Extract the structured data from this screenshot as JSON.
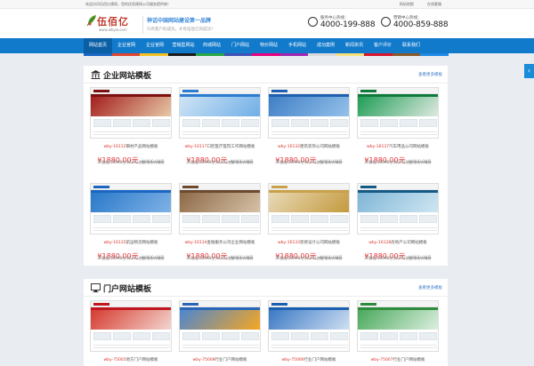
{
  "topbar": {
    "welcome": "欢迎访问伍佰亿建网，您的优质建网公司服务提供商！",
    "links": [
      "网站地图",
      "在线客服"
    ]
  },
  "brand": {
    "logo_text": "伍佰亿",
    "domain": "www.wbyw.com",
    "slogan": "神话中国网站建设第一品牌",
    "subslogan": "只有客户的成功，才有伍佰亿的成功！"
  },
  "hotlines": [
    {
      "label": "服务中心热线：",
      "number": "4000-199-888"
    },
    {
      "label": "营销中心热线：",
      "number": "4000-859-888"
    }
  ],
  "nav": [
    "网站首页",
    "企业官网",
    "企业官网",
    "营销型网站",
    "商城网站",
    "门户网站",
    "特价网站",
    "手机网站",
    "成功案例",
    "新闻资讯",
    "客户评价",
    "联系我们"
  ],
  "colorstrip": [
    "#1a66c4",
    "#e0452e",
    "#f5c022",
    "#1b1b1b",
    "#28a745",
    "#3f51b5",
    "#e6007e",
    "#9c27b0",
    "#d9d9d9",
    "#f5e07a",
    "#d7152d",
    "#8b5a2b",
    "#1e88e5"
  ],
  "side_tab": "‹",
  "section1": {
    "title": "企业网站模板",
    "more": "查看更多模板",
    "cards": [
      {
        "code": "wby-16112",
        "name": "钢材产品网站模板",
        "price": "¥1880.00元",
        "orig": "¥4800.00元",
        "desc": "20套组/200MB空间/20G流量/送永久域名",
        "theme": {
          "nav": "#7d1010",
          "banner": "#a41e1e",
          "accent": "#e7c9a6"
        }
      },
      {
        "code": "wby-16117",
        "name": "口腔医疗医院工作网站模板",
        "price": "¥1880.00元",
        "orig": "¥4800.00元",
        "desc": "20套组/200MB空间/20G流量/送永久域名",
        "theme": {
          "nav": "#2b7bd1",
          "banner": "#cfe4f5",
          "accent": "#6faee6"
        }
      },
      {
        "code": "wby-16132",
        "name": "建筑装饰公司网站模板",
        "price": "¥1880.00元",
        "orig": "¥4800.00元",
        "desc": "20套组/200MB空间/20G流量/送永久域名",
        "theme": {
          "nav": "#1d5fb0",
          "banner": "#3f7fc6",
          "accent": "#95c1ea"
        }
      },
      {
        "code": "wby-16137",
        "name": "汽车用品公司网站模板",
        "price": "¥1880.00元",
        "orig": "¥4800.00元",
        "desc": "20套组/200MB空间/20G流量/送永久域名",
        "theme": {
          "nav": "#0f7a3a",
          "banner": "#1f9d55",
          "accent": "#dfe9e1"
        }
      },
      {
        "code": "wby-16135",
        "name": "航运物流网站模板",
        "price": "¥1880.00元",
        "orig": "¥4800.00元",
        "desc": "20套组/200MB空间/20G流量/送永久域名",
        "theme": {
          "nav": "#1b66c2",
          "banner": "#2a79c9",
          "accent": "#7fb2e6"
        }
      },
      {
        "code": "wby-16134",
        "name": "金融服务公司企业网站模板",
        "price": "¥1880.00元",
        "orig": "¥4800.00元",
        "desc": "20套组/200MB空间/20G流量/送永久域名",
        "theme": {
          "nav": "#6b4a2f",
          "banner": "#8d6a48",
          "accent": "#d6c1a6"
        }
      },
      {
        "code": "wby-16133",
        "name": "装修设计公司网站模板",
        "price": "¥1880.00元",
        "orig": "¥4800.00元",
        "desc": "20套组/200MB空间/20G流量/送永久域名",
        "theme": {
          "nav": "#c9a14a",
          "banner": "#e8d9b7",
          "accent": "#c49a3d"
        }
      },
      {
        "code": "wby-16128",
        "name": "房地产公司网站模板",
        "price": "¥1880.00元",
        "orig": "¥4800.00元",
        "desc": "20套组/200MB空间/20G流量/送永久域名",
        "theme": {
          "nav": "#155a86",
          "banner": "#7fb6d6",
          "accent": "#cfe6f2"
        }
      }
    ]
  },
  "section2": {
    "title": "门户网站模板",
    "more": "查看更多模板",
    "cards": [
      {
        "code": "wby-75005",
        "name": "地方门户网站模板",
        "theme": {
          "nav": "#c0161e",
          "banner": "#d53b2f",
          "accent": "#f3d5cf"
        }
      },
      {
        "code": "wby-75008",
        "name": "行业门户网站模板",
        "theme": {
          "nav": "#2966b8",
          "banner": "#4d86cf",
          "accent": "#f5a623"
        }
      },
      {
        "code": "wby-75006",
        "name": "行业门户网站模板",
        "theme": {
          "nav": "#1b5fb2",
          "banner": "#3a78c4",
          "accent": "#cfdff2"
        }
      },
      {
        "code": "wby-75007",
        "name": "行业门户网站模板",
        "theme": {
          "nav": "#2e8b3c",
          "banner": "#49a85b",
          "accent": "#dcefdf"
        }
      }
    ]
  }
}
